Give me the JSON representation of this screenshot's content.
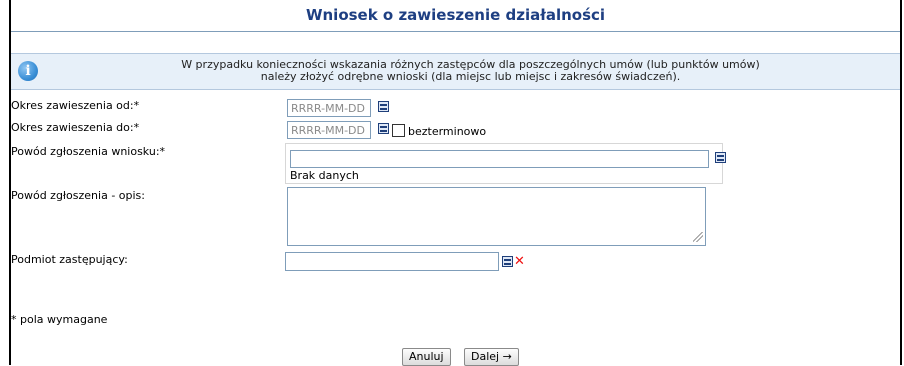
{
  "page": {
    "title": "Wniosek o zawieszenie działalności"
  },
  "info": {
    "icon": "info-icon",
    "line1": "W przypadku konieczności wskazania różnych zastępców dla poszczególnych umów (lub punktów umów)",
    "line2": "należy złożyć odrębne wnioski (dla miejsc lub miejsc i zakresów świadczeń)."
  },
  "form": {
    "date_from": {
      "label": "Okres zawieszenia od:*",
      "placeholder": "RRRR-MM-DD",
      "value": ""
    },
    "date_to": {
      "label": "Okres zawieszenia do:*",
      "placeholder": "RRRR-MM-DD",
      "value": ""
    },
    "indefinite": {
      "label": "bezterminowo",
      "checked": false
    },
    "reason": {
      "label": "Powód zgłoszenia wniosku:*",
      "value": "",
      "note": "Brak danych"
    },
    "description": {
      "label": "Powód zgłoszenia - opis:",
      "value": ""
    },
    "substitute": {
      "label": "Podmiot zastępujący:",
      "value": ""
    },
    "required_note": "* pola wymagane"
  },
  "buttons": {
    "cancel": "Anuluj",
    "next": "Dalej →"
  },
  "colors": {
    "title": "#1e3f82",
    "info_bg": "#e7f0f9",
    "clear_icon": "#e11111"
  }
}
